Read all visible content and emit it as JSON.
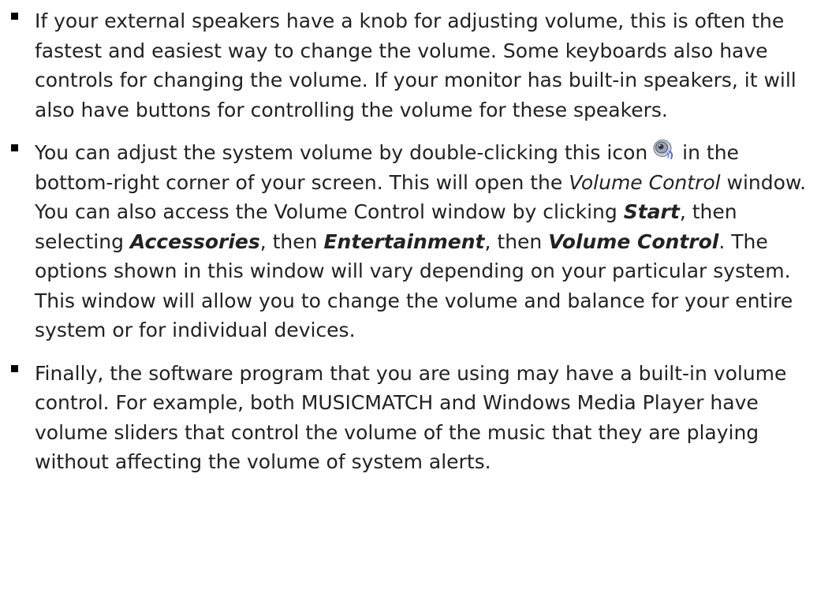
{
  "bullets": {
    "b1": {
      "text": "If your external speakers have a knob for adjusting volume, this is often the fastest and easiest way to change the volume. Some keyboards also have controls for changing the volume. If your monitor has built-in speakers, it will also have buttons for controlling the volume for these speakers."
    },
    "b2": {
      "t1": "You can adjust the system volume by double-clicking this icon",
      "icon": "speaker-volume-icon",
      "t2": " in the bottom-right corner of your screen. This will open the ",
      "e1": "Volume Control",
      "t3": " window. You can also access the Volume Control window by clicking ",
      "s1": "Start",
      "t4": ", then selecting ",
      "s2": "Accessories",
      "t5": ", then ",
      "s3": "Entertainment",
      "t6": ", then ",
      "s4": "Volume Control",
      "t7": ". The options shown in this window will vary depending on your particular system. This window will allow you to change the volume and balance for your entire system or for individual devices."
    },
    "b3": {
      "text": "Finally, the software program that you are using may have a built-in volume control. For example, both MUSICMATCH and Windows Media Player have volume sliders that control the volume of the music that they are playing without affecting the volume of system alerts."
    }
  },
  "colors": {
    "text": "#222222",
    "bullet": "#000000",
    "icon_body": "#9aa3b5",
    "icon_accent": "#5b6fd6"
  }
}
